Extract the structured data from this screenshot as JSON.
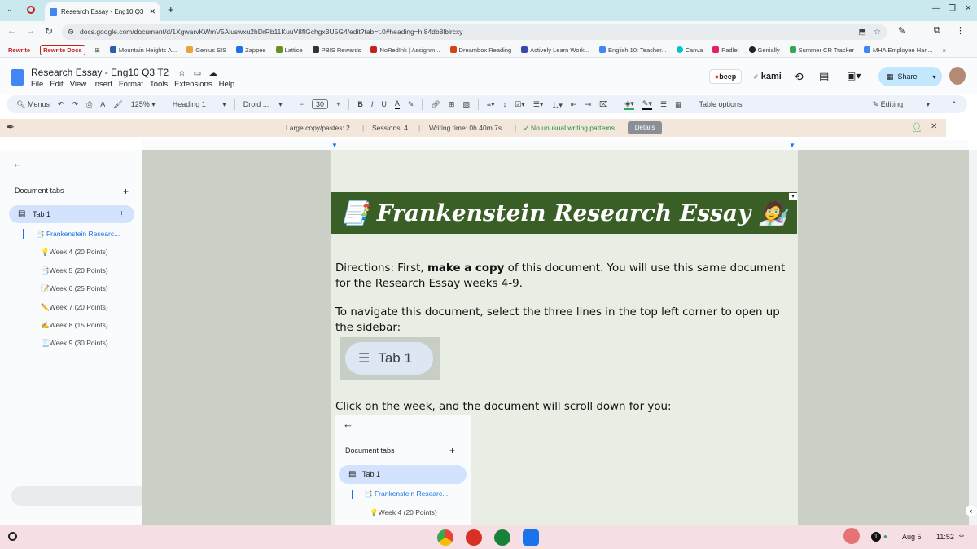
{
  "browser": {
    "tab_title": "Research Essay - Eng10 Q3 T2",
    "url": "docs.google.com/document/d/1XgwarvKWmV5Aluswxu2hDrRb11KuuV8flGchgx3U5G4/edit?tab=t.0#heading=h.84db8lblrcxy",
    "new_tab": "+",
    "bookmarks": [
      "Rewrite",
      "Rewrite Docs",
      "Mountain Heights A...",
      "Genius SIS",
      "Zappee",
      "Lattice",
      "PBIS Rewards",
      "NoRedInk | Assignm...",
      "Dreambox Reading",
      "Actively Learn Work...",
      "English 10: Teacher...",
      "Canva",
      "Padlet",
      "Genially",
      "Summer CR Tracker",
      "MHA Employee Han..."
    ],
    "bookmarks_more": "»"
  },
  "docs": {
    "title": "Research Essay - Eng10 Q3 T2",
    "menus": [
      "File",
      "Edit",
      "View",
      "Insert",
      "Format",
      "Tools",
      "Extensions",
      "Help"
    ],
    "beep_label": "beep",
    "kami_label": "kami",
    "share_label": "Share"
  },
  "toolbar": {
    "menus_label": "Menus",
    "zoom": "125%",
    "style": "Heading 1",
    "font": "Droid ...",
    "font_size": "30",
    "table_options": "Table options",
    "mode": "Editing"
  },
  "extension_bar": {
    "large_copy": "Large copy/pastes: 2",
    "sessions": "Sessions: 4",
    "writing_time": "Writing time: 0h 40m 7s",
    "patterns": "No unusual writing patterns",
    "details": "Details"
  },
  "sidebar": {
    "heading": "Document tabs",
    "add": "+",
    "tab_label": "Tab 1",
    "items": [
      "📑 Frankenstein Researc...",
      "💡Week 4 (20 Points)",
      "📑Week 5 (20 Points)",
      "📝Week 6 (25 Points)",
      "✏️Week 7 (20 Points)",
      "✍️Week 8 (15 Points)",
      "📃Week 9 (30 Points)"
    ]
  },
  "document": {
    "banner": "📑 Frankenstein Research Essay 🧑‍🔬",
    "p1_a": "Directions: First, ",
    "p1_b": "make a copy",
    "p1_c": " of this document. You will use this same document for the Research Essay weeks 4-9.",
    "p2": "To navigate this document, select the three lines in the top left corner to open up the sidebar:",
    "img_tab_label": "Tab 1",
    "p3": "Click on the week, and the document will scroll down for you:",
    "img_side_heading": "Document tabs",
    "img_side_add": "+",
    "img_side_tab": "Tab 1",
    "img_side_item1": "📑 Frankenstein Researc...",
    "img_side_item2": "💡Week 4 (20 Points)"
  },
  "taskbar": {
    "date": "Aug 5",
    "time": "11:52",
    "notif_count": "1"
  }
}
